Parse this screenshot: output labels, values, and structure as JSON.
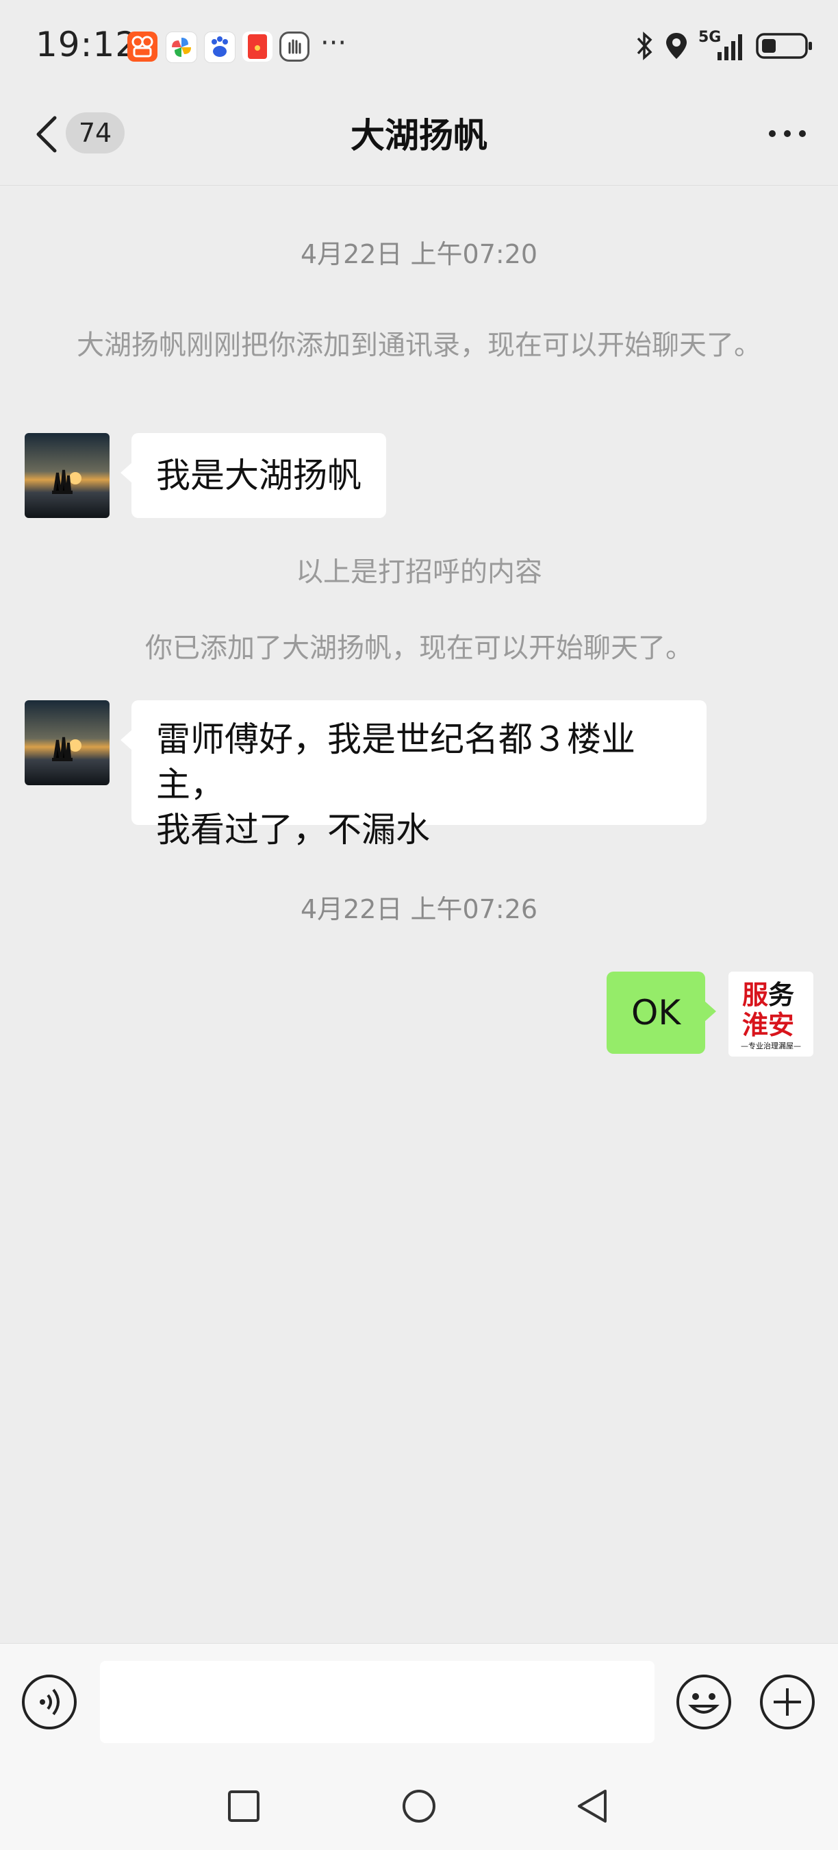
{
  "status_bar": {
    "time": "19:12",
    "app_icons": [
      "kuaishou-icon",
      "pinwheel-app-icon",
      "baidu-icon",
      "red-envelope-icon",
      "hand-app-icon"
    ],
    "more": "···",
    "network": "5G",
    "battery_level": 0.35
  },
  "header": {
    "unread_count": "74",
    "title": "大湖扬帆"
  },
  "messages": {
    "timestamp_1": "4月22日 上午07:20",
    "system_added": "大湖扬帆刚刚把你添加到通讯录，现在可以开始聊天了。",
    "greeting_text": "我是大湖扬帆",
    "greeting_note": "以上是打招呼的内容",
    "system_added_2": "你已添加了大湖扬帆，现在可以开始聊天了。",
    "message_2_line1": "雷师傅好，我是世纪名都３楼业主，",
    "message_2_line2": "我看过了，不漏水",
    "timestamp_2": "4月22日 上午07:26",
    "reply": "OK"
  },
  "my_avatar": {
    "line1_a": "服",
    "line1_b": "务",
    "line2_a": "淮",
    "line2_b": "安",
    "tagline": "—专业治理漏屋—"
  },
  "colors": {
    "background": "#EDEDED",
    "sent_bubble": "#95EC69",
    "received_bubble": "#FFFFFF",
    "system_text": "#9A9A9A"
  }
}
